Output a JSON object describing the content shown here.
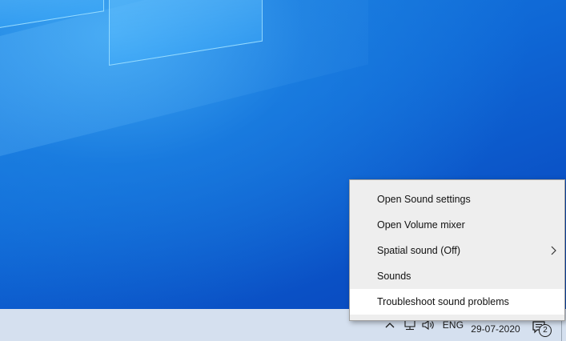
{
  "context_menu": {
    "items": [
      {
        "label": "Open Sound settings",
        "has_submenu": false,
        "highlighted": false
      },
      {
        "label": "Open Volume mixer",
        "has_submenu": false,
        "highlighted": false
      },
      {
        "label": "Spatial sound (Off)",
        "has_submenu": true,
        "highlighted": false
      },
      {
        "label": "Sounds",
        "has_submenu": false,
        "highlighted": false
      },
      {
        "label": "Troubleshoot sound problems",
        "has_submenu": false,
        "highlighted": true
      }
    ]
  },
  "taskbar": {
    "tray_icons": [
      "chevron-up-icon",
      "network-icon",
      "volume-icon"
    ],
    "language": "ENG",
    "date": "29-07-2020",
    "notification_count": "2"
  },
  "colors": {
    "desktop_blue": "#0f68d6",
    "taskbar": "#d5e0ef",
    "menu_bg": "#eeeeee",
    "menu_highlight": "#ffffff"
  }
}
